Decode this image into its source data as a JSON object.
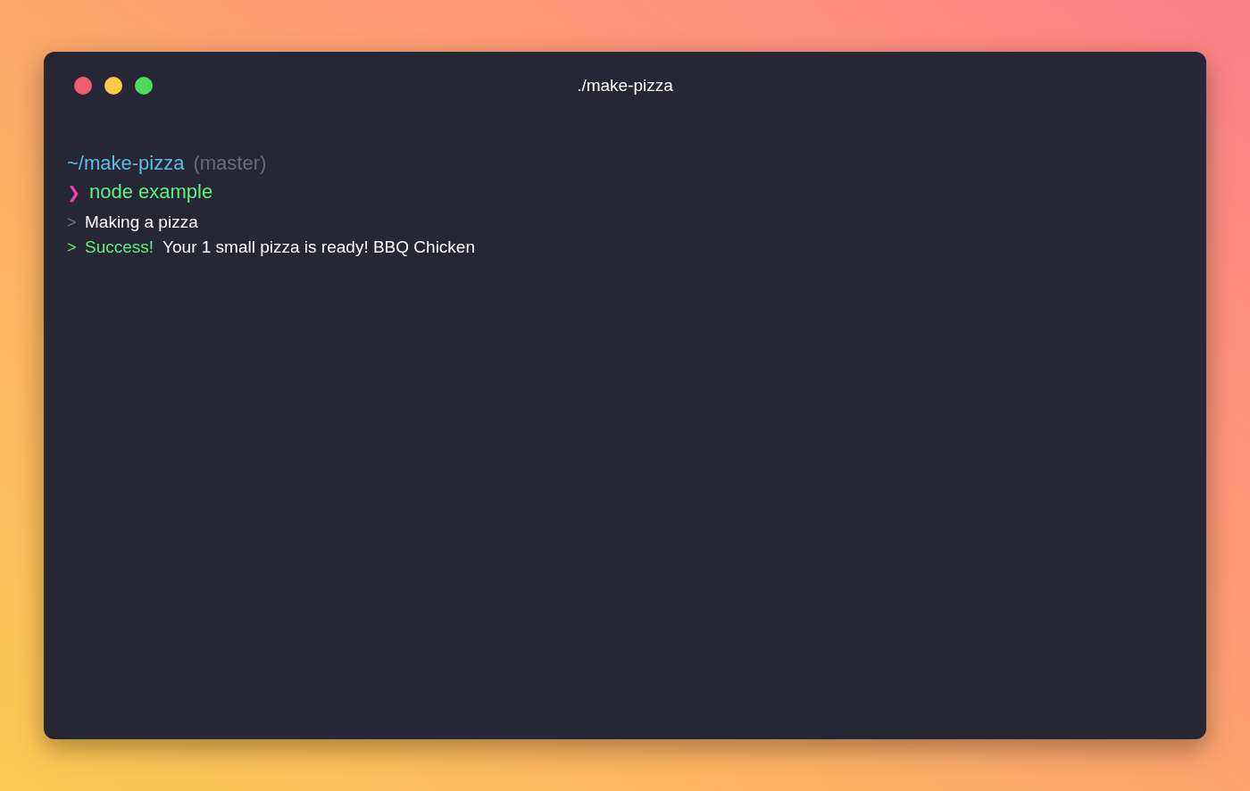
{
  "window": {
    "title": "./make-pizza",
    "buttons": [
      {
        "color": "#f25c6e"
      },
      {
        "color": "#fbc94a"
      },
      {
        "color": "#4ddc58"
      }
    ]
  },
  "prompt": {
    "path": "~/make-pizza",
    "branch": "(master)",
    "marker": "❯",
    "command": "node example"
  },
  "output": [
    {
      "kind": "info",
      "marker": ">",
      "text": "Making a pizza"
    },
    {
      "kind": "success",
      "marker": ">",
      "status": "Success!",
      "text": "Your 1 small pizza is ready! BBQ Chicken"
    }
  ]
}
